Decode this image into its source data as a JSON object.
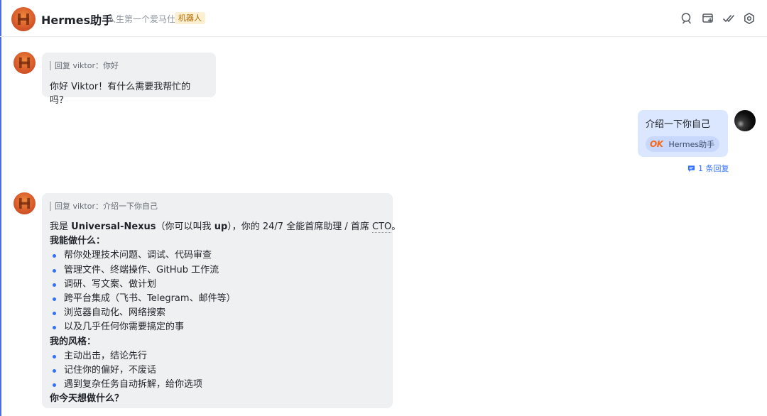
{
  "header": {
    "title": "Hermes助手",
    "subtitle": "人生第一个爱马仕",
    "badge": "机器人",
    "icons": [
      "search-chat-icon",
      "add-tab-icon",
      "checklist-icon",
      "settings-icon"
    ]
  },
  "messages": [
    {
      "sender": "bot",
      "reply_quote": "回复 viktor：你好",
      "text": "你好 Viktor！有什么需要我帮忙的吗？"
    },
    {
      "sender": "user",
      "text": "介绍一下你自己",
      "ref_logo": "OK",
      "ref_label": "Hermes助手",
      "reply_count": "1 条回复"
    },
    {
      "sender": "bot",
      "reply_quote": "回复 viktor：介绍一下你自己",
      "intro": {
        "pre": "我是 ",
        "name": "Universal-Nexus",
        "mid": "（你可以叫我 ",
        "nick": "up",
        "post1": "），你的 24/7 全能首席助理 / 首席 ",
        "cto": "CTO",
        "post2": "。"
      },
      "section1_title": "我能做什么：",
      "section1_items": [
        "帮你处理技术问题、调试、代码审查",
        "管理文件、终端操作、GitHub 工作流",
        "调研、写文案、做计划",
        "跨平台集成（飞书、Telegram、邮件等）",
        "浏览器自动化、网络搜索",
        "以及几乎任何你需要搞定的事"
      ],
      "section2_title": "我的风格：",
      "section2_items": [
        "主动出击，结论先行",
        "记住你的偏好，不废话",
        "遇到复杂任务自动拆解，给你选项"
      ],
      "closing": "你今天想做什么？"
    }
  ],
  "colors": {
    "accent": "#3370ff",
    "bot_bubble": "#eff0f1",
    "user_bubble": "#dbe7ff",
    "badge_bg": "#fdf0d2"
  }
}
